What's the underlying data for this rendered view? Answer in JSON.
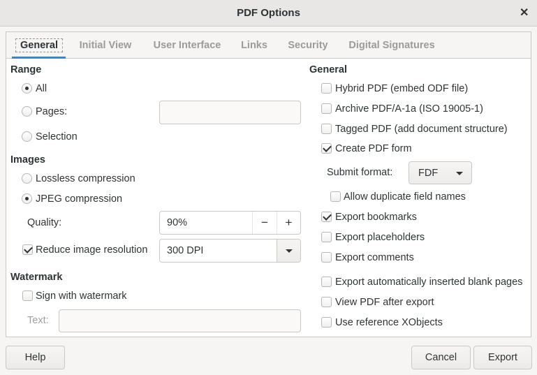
{
  "window": {
    "title": "PDF Options",
    "close_icon": "close-icon"
  },
  "tabs": [
    {
      "label": "General",
      "active": true
    },
    {
      "label": "Initial View"
    },
    {
      "label": "User Interface"
    },
    {
      "label": "Links"
    },
    {
      "label": "Security"
    },
    {
      "label": "Digital Signatures"
    }
  ],
  "accent": "#3584e4",
  "range": {
    "heading": "Range",
    "all": "All",
    "pages": "Pages:",
    "pages_value": "",
    "selection": "Selection",
    "selected": "All"
  },
  "images": {
    "heading": "Images",
    "lossless": "Lossless compression",
    "jpeg": "JPEG compression",
    "selected": "JPEG compression",
    "quality_label": "Quality:",
    "quality_value": "90%",
    "minus": "−",
    "plus": "+",
    "reduce_label": "Reduce image resolution",
    "reduce_checked": true,
    "resolution": "300 DPI"
  },
  "watermark": {
    "heading": "Watermark",
    "sign_label": "Sign with watermark",
    "sign_checked": false,
    "text_label": "Text:",
    "text_value": ""
  },
  "general": {
    "heading": "General",
    "hybrid": "Hybrid PDF (embed ODF file)",
    "archive": "Archive PDF/A-1a (ISO 19005-1)",
    "tagged": "Tagged PDF (add document structure)",
    "form": "Create PDF form",
    "submit_label": "Submit format:",
    "submit_value": "FDF",
    "allow_dup": "Allow duplicate field names",
    "bookmarks": "Export bookmarks",
    "placeholders": "Export placeholders",
    "comments": "Export comments",
    "blank": "Export automatically inserted blank pages",
    "view": "View PDF after export",
    "xobjects": "Use reference XObjects"
  },
  "buttons": {
    "help": "Help",
    "cancel": "Cancel",
    "export": "Export"
  }
}
